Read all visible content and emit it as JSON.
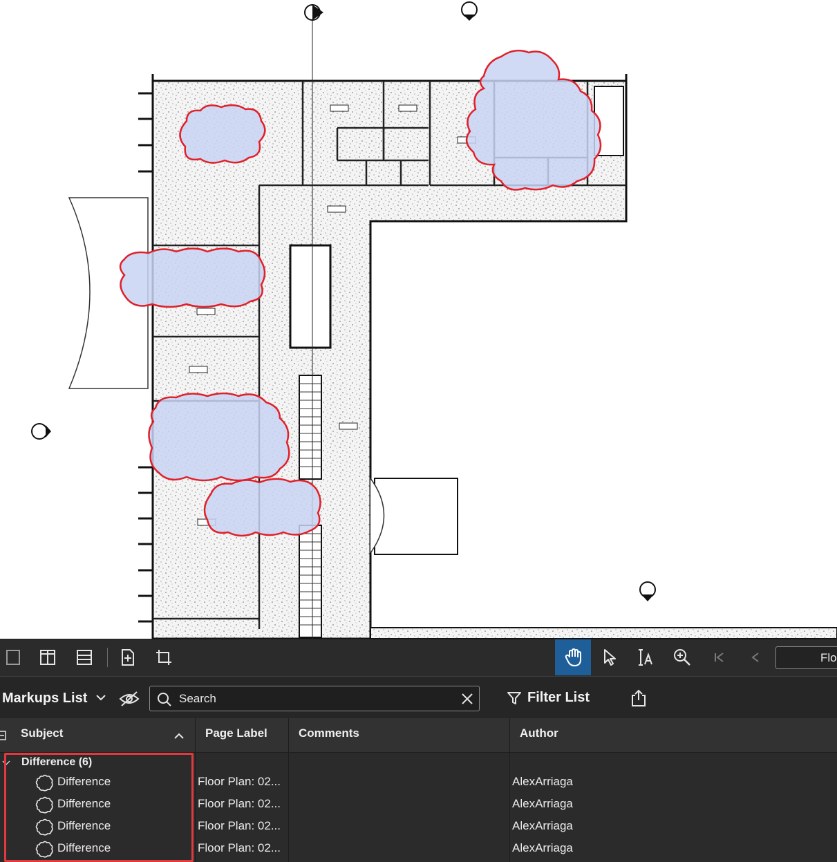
{
  "toolbar": {
    "page_field_value": "Flo"
  },
  "markups_panel": {
    "title": "Markups List",
    "search": {
      "placeholder": "Search",
      "value": ""
    },
    "filter_label": "Filter List",
    "columns": [
      "Subject",
      "Page Label",
      "Comments",
      "Author"
    ],
    "group": {
      "label": "Difference (6)"
    },
    "rows": [
      {
        "subject": "Difference",
        "page_label": "Floor Plan: 02...",
        "comments": "",
        "author": "AlexArriaga"
      },
      {
        "subject": "Difference",
        "page_label": "Floor Plan: 02...",
        "comments": "",
        "author": "AlexArriaga"
      },
      {
        "subject": "Difference",
        "page_label": "Floor Plan: 02...",
        "comments": "",
        "author": "AlexArriaga"
      },
      {
        "subject": "Difference",
        "page_label": "Floor Plan: 02...",
        "comments": "",
        "author": "AlexArriaga"
      }
    ]
  },
  "colors": {
    "cloud_stroke": "#e0202a",
    "cloud_fill": "#c9d3f2",
    "panel_bg": "#2b2b2b",
    "active_tool": "#1e5e99",
    "highlight": "#e0393e"
  },
  "icons": [
    "single-page-icon",
    "split-vertical-icon",
    "split-horizontal-icon",
    "insert-page-icon",
    "crop-page-icon",
    "pan-hand-icon",
    "select-arrow-icon",
    "text-select-icon",
    "zoom-in-icon",
    "first-page-icon",
    "previous-page-icon",
    "chevron-down-icon",
    "eye-off-icon",
    "search-icon",
    "close-icon",
    "filter-icon",
    "export-icon",
    "collapse-all-icon",
    "sort-up-icon",
    "cloud-markup-icon"
  ]
}
